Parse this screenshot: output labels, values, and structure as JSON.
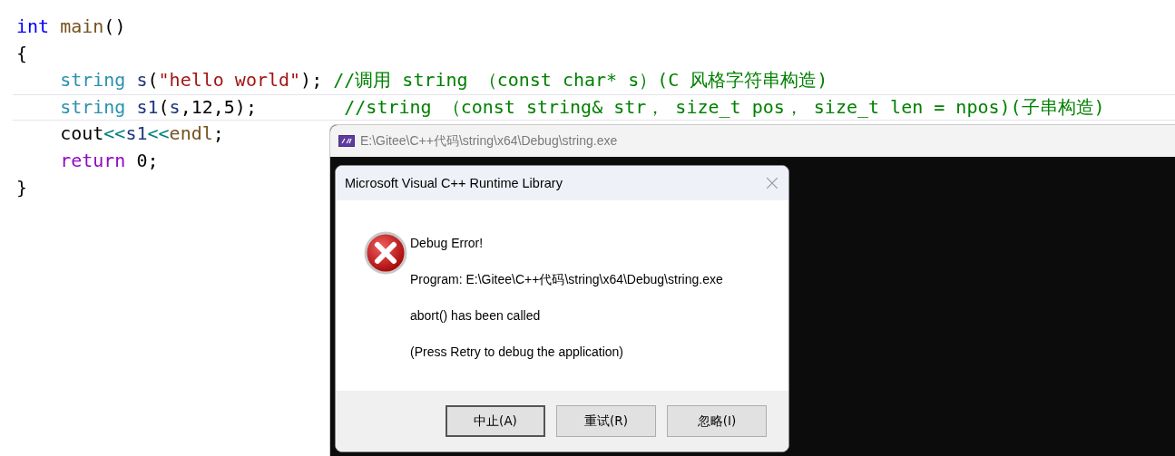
{
  "editor": {
    "lines": [
      {
        "current": false,
        "tokens": [
          {
            "kind": "keyword",
            "text": "int"
          },
          {
            "kind": "func",
            "text": " main"
          },
          {
            "kind": "plain",
            "text": "()"
          }
        ]
      },
      {
        "current": false,
        "tokens": [
          {
            "kind": "plain",
            "text": "{"
          }
        ]
      },
      {
        "current": false,
        "tokens": [
          {
            "kind": "type",
            "text": "    string"
          },
          {
            "kind": "var",
            "text": " s"
          },
          {
            "kind": "plain",
            "text": "("
          },
          {
            "kind": "string",
            "text": "\"hello world\""
          },
          {
            "kind": "plain",
            "text": "); "
          },
          {
            "kind": "comment",
            "text": "//调用 string （const char* s）(C 风格字符串构造)"
          }
        ]
      },
      {
        "current": true,
        "tokens": [
          {
            "kind": "type",
            "text": "    string"
          },
          {
            "kind": "var",
            "text": " s1"
          },
          {
            "kind": "plain",
            "text": "("
          },
          {
            "kind": "var",
            "text": "s"
          },
          {
            "kind": "plain",
            "text": ",12,5);        "
          },
          {
            "kind": "comment",
            "text": "//string （const string& str， size_t pos， size_t len = npos)(子串构造)"
          }
        ]
      },
      {
        "current": false,
        "tokens": [
          {
            "kind": "plain",
            "text": "    cout"
          },
          {
            "kind": "operator",
            "text": "<<"
          },
          {
            "kind": "var",
            "text": "s1"
          },
          {
            "kind": "operator",
            "text": "<<"
          },
          {
            "kind": "func",
            "text": "endl"
          },
          {
            "kind": "plain",
            "text": ";"
          }
        ]
      },
      {
        "current": false,
        "tokens": [
          {
            "kind": "control",
            "text": "    return"
          },
          {
            "kind": "plain",
            "text": " 0;"
          }
        ]
      },
      {
        "current": false,
        "tokens": [
          {
            "kind": "plain",
            "text": "}"
          }
        ]
      }
    ]
  },
  "console": {
    "title": "E:\\Gitee\\C++代码\\string\\x64\\Debug\\string.exe",
    "dialog": {
      "title": "Microsoft Visual C++ Runtime Library",
      "messages": [
        "Debug Error!",
        "Program: E:\\Gitee\\C++代码\\string\\x64\\Debug\\string.exe",
        "abort() has been called",
        "(Press Retry to debug the application)"
      ],
      "buttons": [
        {
          "label": "中止(A)",
          "selected": true
        },
        {
          "label": "重试(R)",
          "selected": false
        },
        {
          "label": "忽略(I)",
          "selected": false
        }
      ]
    }
  }
}
